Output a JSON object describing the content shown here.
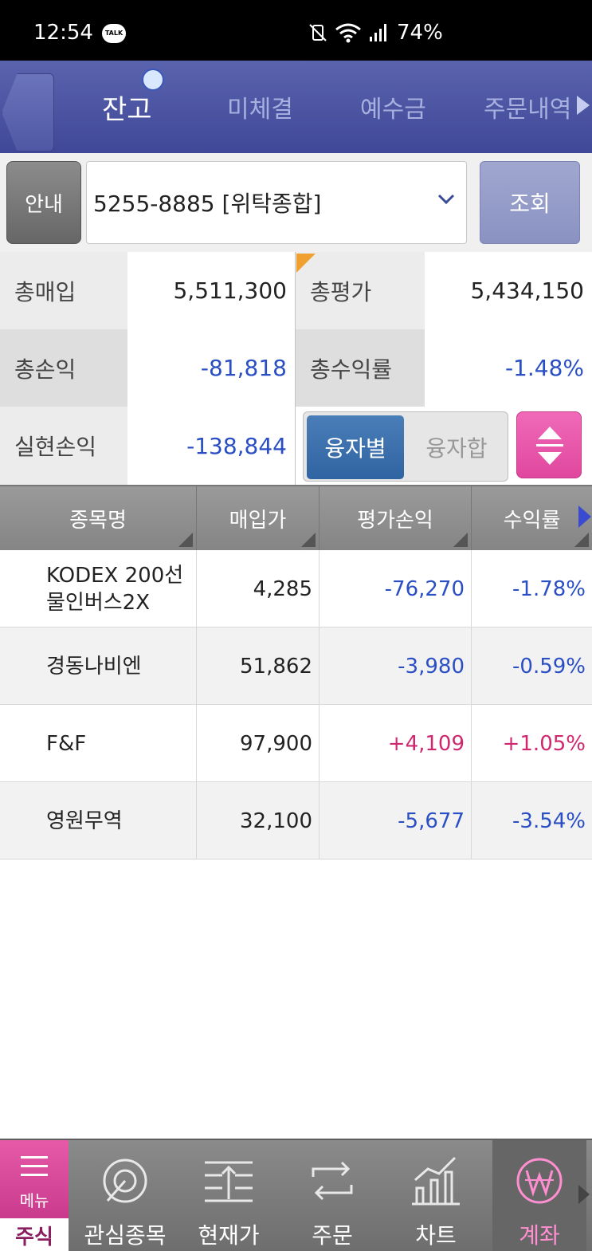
{
  "status_bar": {
    "time": "12:54",
    "talk_label": "TALK",
    "battery": "74%"
  },
  "header": {
    "tabs": [
      {
        "label": "잔고",
        "active": true
      },
      {
        "label": "미체결"
      },
      {
        "label": "예수금"
      },
      {
        "label": "주문내역"
      }
    ]
  },
  "account": {
    "guide_label": "안내",
    "selected": "5255-8885 [위탁종합]",
    "query_label": "조회"
  },
  "summary": {
    "total_purchase_label": "총매입",
    "total_purchase_value": "5,511,300",
    "total_eval_label": "총평가",
    "total_eval_value": "5,434,150",
    "total_pl_label": "총손익",
    "total_pl_value": "-81,818",
    "total_return_label": "총수익률",
    "total_return_value": "-1.48%",
    "realized_pl_label": "실현손익",
    "realized_pl_value": "-138,844",
    "toggle_on_label": "융자별",
    "toggle_off_label": "융자합"
  },
  "table": {
    "columns": [
      "종목명",
      "매입가",
      "평가손익",
      "수익률"
    ],
    "rows": [
      {
        "name": "KODEX 200선물인버스2X",
        "price": "4,285",
        "pl": "-76,270",
        "rate": "-1.78%",
        "sign": "neg"
      },
      {
        "name": "경동나비엔",
        "price": "51,862",
        "pl": "-3,980",
        "rate": "-0.59%",
        "sign": "neg"
      },
      {
        "name": "F&F",
        "price": "97,900",
        "pl": "+4,109",
        "rate": "+1.05%",
        "sign": "pos"
      },
      {
        "name": "영원무역",
        "price": "32,100",
        "pl": "-5,677",
        "rate": "-3.54%",
        "sign": "neg"
      }
    ]
  },
  "bottom_nav": {
    "menu_label": "메뉴",
    "section_label": "주식",
    "items": [
      {
        "label": "관심종목",
        "icon": "target-icon"
      },
      {
        "label": "현재가",
        "icon": "price-icon"
      },
      {
        "label": "주문",
        "icon": "exchange-icon"
      },
      {
        "label": "차트",
        "icon": "chart-icon"
      },
      {
        "label": "계좌",
        "icon": "won-icon",
        "active": true
      }
    ]
  },
  "colors": {
    "header": "#4a53a3",
    "negative": "#2a4fc4",
    "positive": "#d0286e",
    "accent_pink": "#e0479e",
    "toggle_blue": "#2f64a2"
  }
}
